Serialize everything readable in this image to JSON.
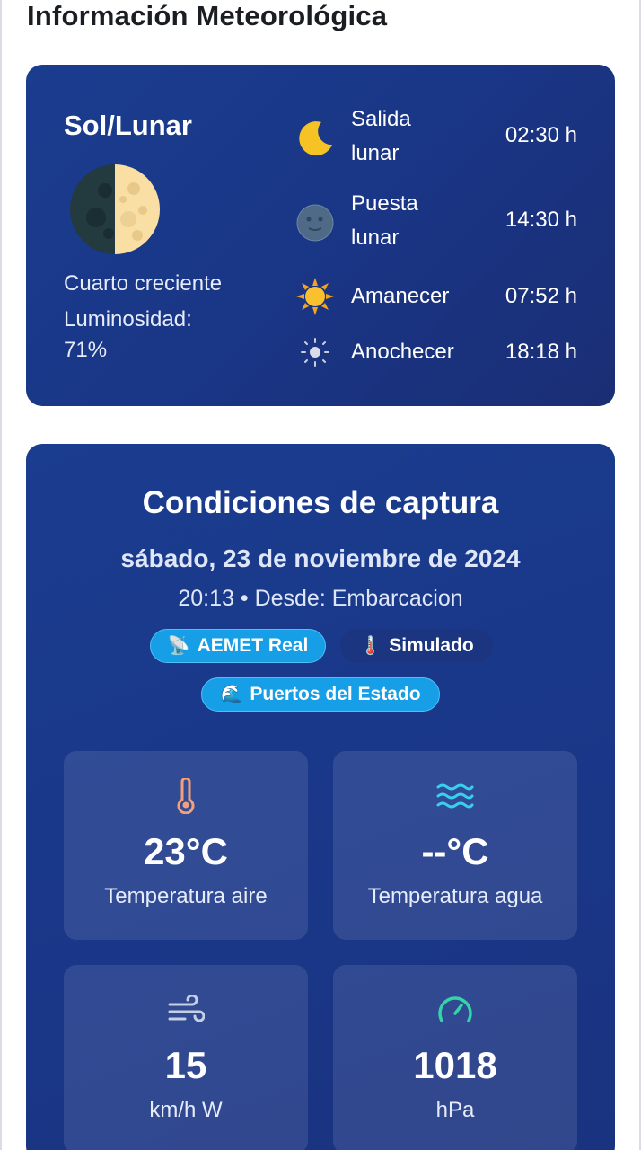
{
  "page": {
    "title": "Información Meteorológica"
  },
  "sun_moon": {
    "title": "Sol/Lunar",
    "phase_name": "Cuarto creciente",
    "luminosity_label": "Luminosidad:",
    "luminosity_value": "71%",
    "events": [
      {
        "label_line1": "Salida",
        "label_line2": "lunar",
        "time": "02:30 h",
        "icon": "crescent-moon-icon"
      },
      {
        "label_line1": "Puesta",
        "label_line2": "lunar",
        "time": "14:30 h",
        "icon": "new-moon-face-icon"
      },
      {
        "label_line1": "Amanecer",
        "label_line2": "",
        "time": "07:52 h",
        "icon": "sun-icon"
      },
      {
        "label_line1": "Anochecer",
        "label_line2": "",
        "time": "18:18 h",
        "icon": "dim-sun-icon"
      }
    ]
  },
  "conditions": {
    "title": "Condiciones de captura",
    "date": "sábado, 23 de noviembre de 2024",
    "time_origin": "20:13 • Desde: Embarcacion",
    "badges": [
      {
        "icon": "📡",
        "label": "AEMET Real"
      },
      {
        "icon": "🌡️",
        "label": "Simulado"
      },
      {
        "icon": "🌊",
        "label": "Puertos del Estado"
      }
    ],
    "tiles": [
      {
        "icon": "thermometer-icon",
        "value": "23°C",
        "label": "Temperatura aire"
      },
      {
        "icon": "water-waves-icon",
        "value": "--°C",
        "label": "Temperatura agua"
      },
      {
        "icon": "wind-icon",
        "value": "15",
        "label": "km/h W"
      },
      {
        "icon": "gauge-icon",
        "value": "1018",
        "label": "hPa"
      }
    ]
  },
  "colors": {
    "card_bg": "#1a3585",
    "badge_blue": "#169ee6",
    "thermometer": "#f2a07b",
    "waves": "#38d0f0",
    "gauge": "#34d3a8"
  }
}
